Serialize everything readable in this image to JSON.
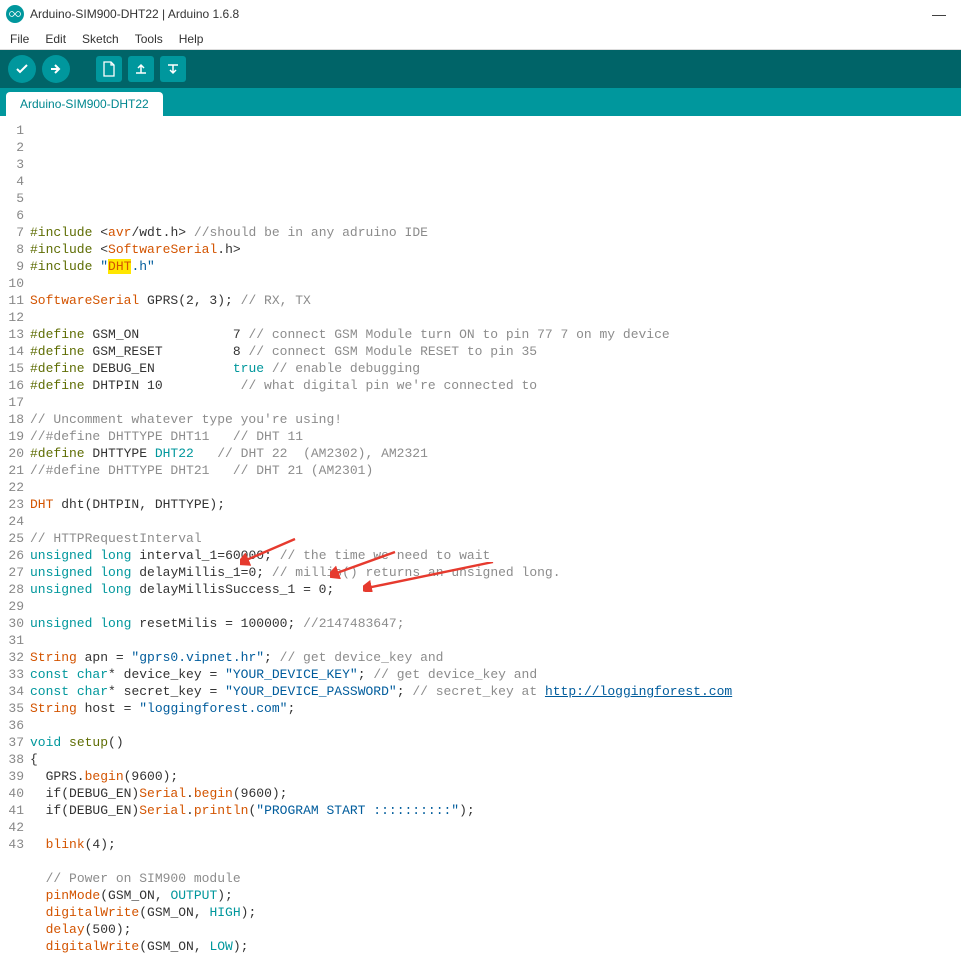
{
  "window": {
    "title": "Arduino-SIM900-DHT22 | Arduino 1.6.8"
  },
  "menu": [
    "File",
    "Edit",
    "Sketch",
    "Tools",
    "Help"
  ],
  "tab": {
    "label": "Arduino-SIM900-DHT22"
  },
  "toolbar": {
    "verify": "verify",
    "upload": "upload",
    "new": "new",
    "open": "open",
    "save": "save"
  },
  "code": {
    "lines": [
      {
        "n": 1,
        "tokens": [
          {
            "t": "#include",
            "c": "kw-green"
          },
          {
            "t": " <"
          },
          {
            "t": "avr",
            "c": "tk-orange"
          },
          {
            "t": "/"
          },
          {
            "t": "wdt"
          },
          {
            "t": "."
          },
          {
            "t": "h"
          },
          {
            "t": "> "
          },
          {
            "t": "//should be in any adruino IDE",
            "c": "tk-comment"
          }
        ]
      },
      {
        "n": 2,
        "tokens": [
          {
            "t": "#include",
            "c": "kw-green"
          },
          {
            "t": " <"
          },
          {
            "t": "SoftwareSerial",
            "c": "tk-orange"
          },
          {
            "t": "."
          },
          {
            "t": "h"
          },
          {
            "t": ">"
          }
        ]
      },
      {
        "n": 3,
        "tokens": [
          {
            "t": "#include",
            "c": "kw-green"
          },
          {
            "t": " "
          },
          {
            "t": "\"",
            "c": "tk-string"
          },
          {
            "t": "DHT",
            "c": "tk-orange sel-yellow"
          },
          {
            "t": ".h\"",
            "c": "tk-string"
          }
        ]
      },
      {
        "n": 4,
        "tokens": []
      },
      {
        "n": 5,
        "tokens": [
          {
            "t": "SoftwareSerial",
            "c": "tk-orange"
          },
          {
            "t": " GPRS(2, 3); "
          },
          {
            "t": "// RX, TX",
            "c": "tk-comment"
          }
        ]
      },
      {
        "n": 6,
        "tokens": []
      },
      {
        "n": 7,
        "tokens": [
          {
            "t": "#define",
            "c": "kw-green"
          },
          {
            "t": " GSM_ON            7 "
          },
          {
            "t": "// connect GSM Module turn ON to pin 77 7 on my device",
            "c": "tk-comment"
          }
        ]
      },
      {
        "n": 8,
        "tokens": [
          {
            "t": "#define",
            "c": "kw-green"
          },
          {
            "t": " GSM_RESET         8 "
          },
          {
            "t": "// connect GSM Module RESET to pin 35",
            "c": "tk-comment"
          }
        ]
      },
      {
        "n": 9,
        "tokens": [
          {
            "t": "#define",
            "c": "kw-green"
          },
          {
            "t": " DEBUG_EN          "
          },
          {
            "t": "true",
            "c": "tk-teal"
          },
          {
            "t": " "
          },
          {
            "t": "// enable debugging",
            "c": "tk-comment"
          }
        ]
      },
      {
        "n": 10,
        "tokens": [
          {
            "t": "#define",
            "c": "kw-green"
          },
          {
            "t": " DHTPIN 10          "
          },
          {
            "t": "// what digital pin we're connected to",
            "c": "tk-comment"
          }
        ]
      },
      {
        "n": 11,
        "tokens": []
      },
      {
        "n": 12,
        "tokens": [
          {
            "t": "// Uncomment whatever type you're using!",
            "c": "tk-comment"
          }
        ]
      },
      {
        "n": 13,
        "tokens": [
          {
            "t": "//#define DHTTYPE DHT11   // DHT 11",
            "c": "tk-comment"
          }
        ]
      },
      {
        "n": 14,
        "tokens": [
          {
            "t": "#define",
            "c": "kw-green"
          },
          {
            "t": " DHTTYPE "
          },
          {
            "t": "DHT22",
            "c": "tk-teal"
          },
          {
            "t": "   "
          },
          {
            "t": "// DHT 22  (AM2302), AM2321",
            "c": "tk-comment"
          }
        ]
      },
      {
        "n": 15,
        "tokens": [
          {
            "t": "//#define DHTTYPE DHT21   // DHT 21 (AM2301)",
            "c": "tk-comment"
          }
        ]
      },
      {
        "n": 16,
        "tokens": []
      },
      {
        "n": 17,
        "tokens": [
          {
            "t": "DHT",
            "c": "tk-orange"
          },
          {
            "t": " dht(DHTPIN, DHTTYPE);"
          }
        ]
      },
      {
        "n": 18,
        "tokens": []
      },
      {
        "n": 19,
        "tokens": [
          {
            "t": "// HTTPRequestInterval",
            "c": "tk-comment"
          }
        ]
      },
      {
        "n": 20,
        "tokens": [
          {
            "t": "unsigned",
            "c": "tk-teal"
          },
          {
            "t": " "
          },
          {
            "t": "long",
            "c": "tk-teal"
          },
          {
            "t": " interval_1=60000; "
          },
          {
            "t": "// the time we need to wait",
            "c": "tk-comment"
          }
        ]
      },
      {
        "n": 21,
        "tokens": [
          {
            "t": "unsigned",
            "c": "tk-teal"
          },
          {
            "t": " "
          },
          {
            "t": "long",
            "c": "tk-teal"
          },
          {
            "t": " delayMillis_1=0; "
          },
          {
            "t": "// millis() returns an unsigned long.",
            "c": "tk-comment"
          }
        ]
      },
      {
        "n": 22,
        "tokens": [
          {
            "t": "unsigned",
            "c": "tk-teal"
          },
          {
            "t": " "
          },
          {
            "t": "long",
            "c": "tk-teal"
          },
          {
            "t": " delayMillisSuccess_1 = 0;"
          }
        ]
      },
      {
        "n": 23,
        "tokens": []
      },
      {
        "n": 24,
        "tokens": [
          {
            "t": "unsigned",
            "c": "tk-teal"
          },
          {
            "t": " "
          },
          {
            "t": "long",
            "c": "tk-teal"
          },
          {
            "t": " resetMilis = 100000; "
          },
          {
            "t": "//2147483647;",
            "c": "tk-comment"
          }
        ]
      },
      {
        "n": 25,
        "tokens": []
      },
      {
        "n": 26,
        "tokens": [
          {
            "t": "String",
            "c": "tk-orange"
          },
          {
            "t": " apn = "
          },
          {
            "t": "\"gprs0.vipnet.hr\"",
            "c": "tk-string"
          },
          {
            "t": "; "
          },
          {
            "t": "// get device_key and",
            "c": "tk-comment"
          }
        ]
      },
      {
        "n": 27,
        "tokens": [
          {
            "t": "const",
            "c": "tk-teal"
          },
          {
            "t": " "
          },
          {
            "t": "char",
            "c": "tk-teal"
          },
          {
            "t": "* device_key = "
          },
          {
            "t": "\"YOUR_DEVICE_KEY\"",
            "c": "tk-string"
          },
          {
            "t": "; "
          },
          {
            "t": "// get device_key and",
            "c": "tk-comment"
          }
        ]
      },
      {
        "n": 28,
        "tokens": [
          {
            "t": "const",
            "c": "tk-teal"
          },
          {
            "t": " "
          },
          {
            "t": "char",
            "c": "tk-teal"
          },
          {
            "t": "* secret_key = "
          },
          {
            "t": "\"YOUR_DEVICE_PASSWORD\"",
            "c": "tk-string"
          },
          {
            "t": "; "
          },
          {
            "t": "// secret_key at ",
            "c": "tk-comment"
          },
          {
            "t": "http://loggingforest.com",
            "c": "tk-comment",
            "link": true
          }
        ]
      },
      {
        "n": 29,
        "tokens": [
          {
            "t": "String",
            "c": "tk-orange"
          },
          {
            "t": " host = "
          },
          {
            "t": "\"loggingforest.com\"",
            "c": "tk-string"
          },
          {
            "t": ";"
          }
        ]
      },
      {
        "n": 30,
        "tokens": []
      },
      {
        "n": 31,
        "tokens": [
          {
            "t": "void",
            "c": "tk-teal"
          },
          {
            "t": " "
          },
          {
            "t": "setup",
            "c": "kw-green"
          },
          {
            "t": "()"
          }
        ]
      },
      {
        "n": 32,
        "tokens": [
          {
            "t": "{"
          }
        ]
      },
      {
        "n": 33,
        "tokens": [
          {
            "t": "  GPRS."
          },
          {
            "t": "begin",
            "c": "tk-orange"
          },
          {
            "t": "(9600);"
          }
        ]
      },
      {
        "n": 34,
        "tokens": [
          {
            "t": "  if(DEBUG_EN)"
          },
          {
            "t": "Serial",
            "c": "tk-orange"
          },
          {
            "t": "."
          },
          {
            "t": "begin",
            "c": "tk-orange"
          },
          {
            "t": "(9600);"
          }
        ]
      },
      {
        "n": 35,
        "tokens": [
          {
            "t": "  if(DEBUG_EN)"
          },
          {
            "t": "Serial",
            "c": "tk-orange"
          },
          {
            "t": "."
          },
          {
            "t": "println",
            "c": "tk-orange"
          },
          {
            "t": "("
          },
          {
            "t": "\"PROGRAM START ::::::::::\"",
            "c": "tk-string"
          },
          {
            "t": ");"
          }
        ]
      },
      {
        "n": 36,
        "tokens": []
      },
      {
        "n": 37,
        "tokens": [
          {
            "t": "  "
          },
          {
            "t": "blink",
            "c": "tk-orange"
          },
          {
            "t": "(4);"
          }
        ]
      },
      {
        "n": 38,
        "tokens": []
      },
      {
        "n": 39,
        "tokens": [
          {
            "t": "  "
          },
          {
            "t": "// Power on SIM900 module",
            "c": "tk-comment"
          }
        ]
      },
      {
        "n": 40,
        "tokens": [
          {
            "t": "  "
          },
          {
            "t": "pinMode",
            "c": "tk-orange"
          },
          {
            "t": "(GSM_ON, "
          },
          {
            "t": "OUTPUT",
            "c": "tk-teal"
          },
          {
            "t": ");"
          }
        ]
      },
      {
        "n": 41,
        "tokens": [
          {
            "t": "  "
          },
          {
            "t": "digitalWrite",
            "c": "tk-orange"
          },
          {
            "t": "(GSM_ON, "
          },
          {
            "t": "HIGH",
            "c": "tk-teal"
          },
          {
            "t": ");"
          }
        ]
      },
      {
        "n": 42,
        "tokens": [
          {
            "t": "  "
          },
          {
            "t": "delay",
            "c": "tk-orange"
          },
          {
            "t": "(500);"
          }
        ]
      },
      {
        "n": 43,
        "tokens": [
          {
            "t": "  "
          },
          {
            "t": "digitalWrite",
            "c": "tk-orange"
          },
          {
            "t": "(GSM_ON, "
          },
          {
            "t": "LOW",
            "c": "tk-teal"
          },
          {
            "t": ");"
          }
        ]
      }
    ]
  }
}
